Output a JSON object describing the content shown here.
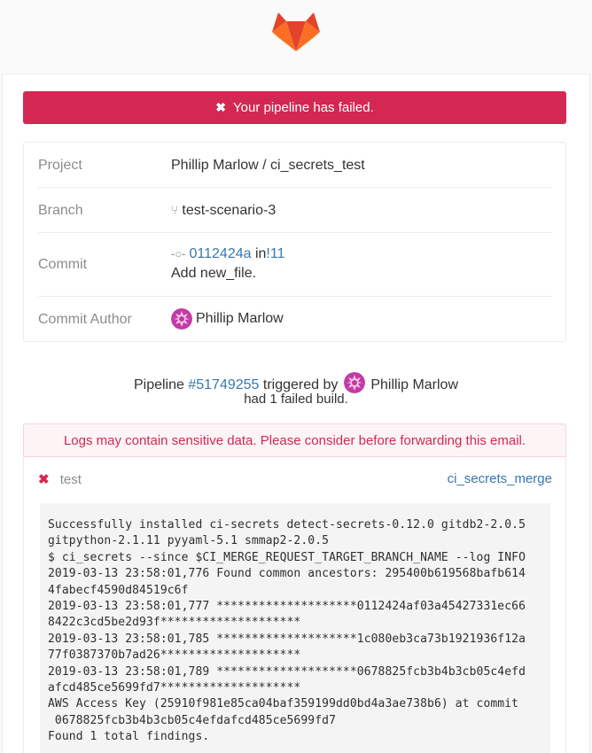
{
  "header": {
    "logo_icon": "gitlab-tanuki-icon"
  },
  "alert": {
    "icon": "close-icon",
    "text": "Your pipeline has failed."
  },
  "info": {
    "project_label": "Project",
    "project_value": "Phillip Marlow / ci_secrets_test",
    "branch_label": "Branch",
    "branch_icon": "branch-icon",
    "branch_value": "test-scenario-3",
    "commit_label": "Commit",
    "commit_icon": "commit-icon",
    "commit_sha": "0112424a",
    "commit_in": "in",
    "commit_mr": "!11",
    "commit_message": "Add new_file.",
    "author_label": "Commit Author",
    "author_name": "Phillip Marlow"
  },
  "summary": {
    "pipeline_prefix": "Pipeline",
    "pipeline_id": "#51749255",
    "triggered_by": "triggered by",
    "user_name": "Phillip Marlow",
    "failed_text": "had 1 failed build."
  },
  "warning": {
    "text": "Logs may contain sensitive data. Please consider before forwarding this email."
  },
  "build": {
    "status_icon": "close-icon",
    "name": "test",
    "link": "ci_secrets_merge",
    "log_lines": [
      "Successfully installed ci-secrets detect-secrets-0.12.0 gitdb2-2.0.5",
      "gitpython-2.1.11 pyyaml-5.1 smmap2-2.0.5",
      "$ ci_secrets --since $CI_MERGE_REQUEST_TARGET_BRANCH_NAME --log INFO",
      "2019-03-13 23:58:01,776 Found common ancestors: 295400b619568bafb614",
      "4fabecf4590d84519c6f",
      "2019-03-13 23:58:01,777 ********************0112424af03a45427331ec66",
      "8422c3cd5be2d93f********************",
      "2019-03-13 23:58:01,785 ********************1c080eb3ca73b1921936f12a",
      "77f0387370b7ad26********************",
      "2019-03-13 23:58:01,789 ********************0678825fcb3b4b3cb05c4efd",
      "afcd485ce5699fd7********************",
      "AWS Access Key (25910f981e85ca04baf359199dd0bd4a3ae738b6) at commit",
      " 0678825fcb3b4b3cb05c4efdafcd485ce5699fd7",
      "Found 1 total findings."
    ]
  },
  "colors": {
    "danger": "#d22852",
    "link": "#3777b0",
    "muted": "#8c8c8c",
    "log_bg": "#f4f4f4",
    "warning_bg": "#fdf4f6"
  }
}
